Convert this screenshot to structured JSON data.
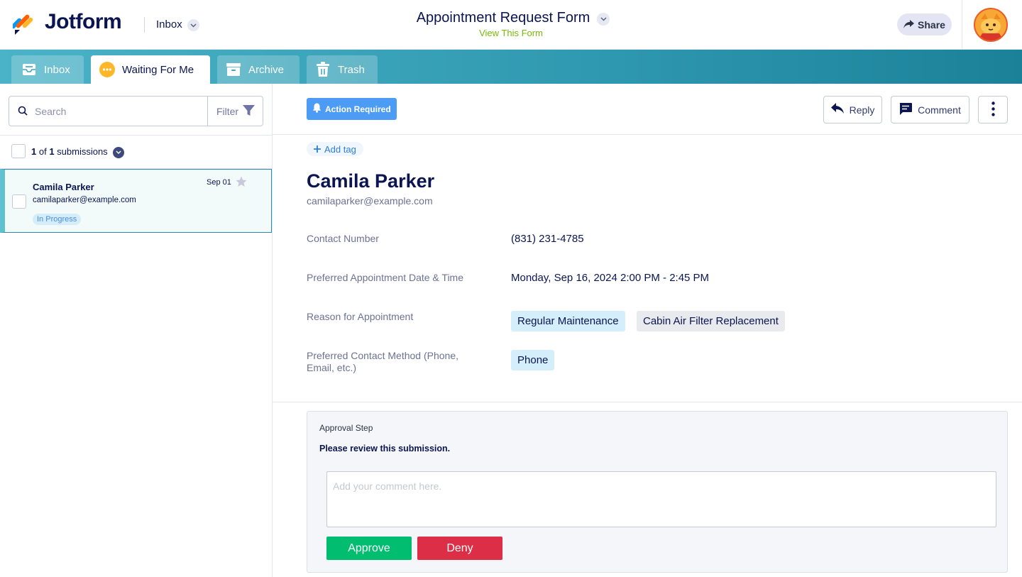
{
  "header": {
    "brand": "Jotform",
    "inbox_label": "Inbox",
    "form_title": "Appointment Request Form",
    "view_form_link": "View This Form",
    "share_label": "Share"
  },
  "tabs": [
    {
      "label": "Inbox",
      "icon": "inbox-icon",
      "active": false
    },
    {
      "label": "Waiting For Me",
      "icon": "waiting-icon",
      "active": true
    },
    {
      "label": "Archive",
      "icon": "archive-icon",
      "active": false
    },
    {
      "label": "Trash",
      "icon": "trash-icon",
      "active": false
    }
  ],
  "sidebar": {
    "search_placeholder": "Search",
    "filter_label": "Filter",
    "count_current": "1",
    "count_of": " of ",
    "count_total": "1",
    "count_suffix": " submissions",
    "submissions": [
      {
        "name": "Camila Parker",
        "email": "camilaparker@example.com",
        "status": "In Progress",
        "date": "Sep 01",
        "starred": false
      }
    ]
  },
  "detail": {
    "action_badge": "Action Required",
    "reply_label": "Reply",
    "comment_label": "Comment",
    "add_tag_label": "Add tag",
    "name": "Camila Parker",
    "email": "camilaparker@example.com",
    "fields": [
      {
        "label": "Contact Number",
        "value": "(831) 231-4785"
      },
      {
        "label": "Preferred Appointment Date & Time",
        "value": "Monday, Sep 16, 2024 2:00 PM - 2:45 PM"
      },
      {
        "label": "Reason for Appointment",
        "chips": [
          "Regular Maintenance",
          "Cabin Air Filter Replacement"
        ]
      },
      {
        "label": "Preferred Contact Method (Phone, Email, etc.)",
        "chips": [
          "Phone"
        ]
      }
    ]
  },
  "approval": {
    "title": "Approval Step",
    "message": "Please review this submission.",
    "comment_placeholder": "Add your comment here.",
    "approve_label": "Approve",
    "deny_label": "Deny"
  },
  "colors": {
    "brand_navy": "#0a1551",
    "tab_gradient_start": "#4bb3c7",
    "tab_gradient_end": "#1b8199",
    "action_blue": "#4c9cf5",
    "approve_green": "#01bd6f",
    "deny_red": "#dc2f47",
    "link_green": "#78bb07"
  }
}
